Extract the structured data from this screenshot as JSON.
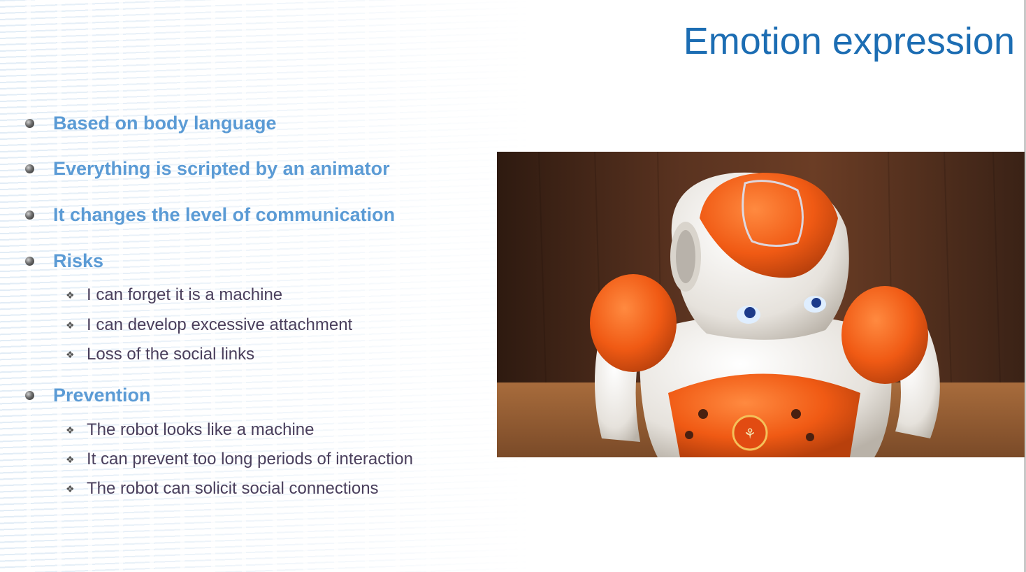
{
  "slide": {
    "title": "Emotion expression",
    "bullets": [
      {
        "text": "Based on body language"
      },
      {
        "text": "Everything is scripted by an animator"
      },
      {
        "text": "It changes the level of communication"
      },
      {
        "text": "Risks",
        "subitems": [
          "I can forget it is a machine",
          "I can develop excessive attachment",
          "Loss of the social links"
        ]
      },
      {
        "text": "Prevention",
        "subitems": [
          "The robot looks like a machine",
          "It can prevent too long periods of interaction",
          "The robot can solicit social connections"
        ]
      }
    ],
    "bullet_marker": "❖",
    "colors": {
      "title": "#1c6db3",
      "level1": "#5b9bd5",
      "level2": "#4a3f5c",
      "robot_orange": "#f05a14"
    }
  }
}
